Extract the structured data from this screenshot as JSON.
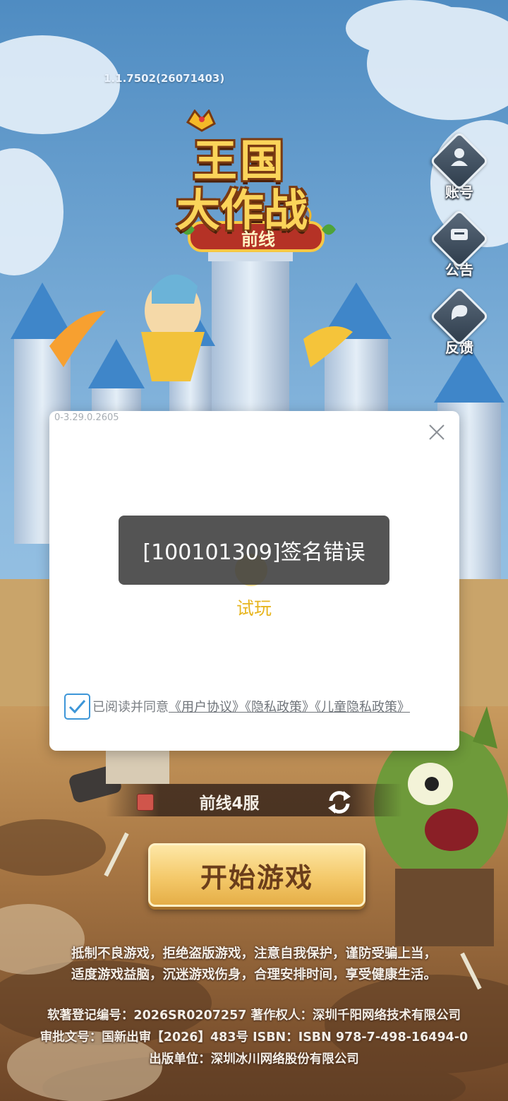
{
  "version": "1.1.7502(26071403)",
  "logo": {
    "title_line1": "王国",
    "title_line2": "大作战",
    "subtitle": "前线"
  },
  "side_menu": [
    {
      "label": "账号",
      "icon": "user-icon"
    },
    {
      "label": "公告",
      "icon": "notice-icon"
    },
    {
      "label": "反馈",
      "icon": "feedback-icon"
    }
  ],
  "dialog": {
    "version": "0-3.29.0.2605",
    "toast": "[100101309]签名错误",
    "trial_label": "试玩",
    "agreement": {
      "checked": true,
      "prefix": "已阅读并同意",
      "links": "《用户协议》《隐私政策》《儿童隐私政策》"
    }
  },
  "server": {
    "name": "前线4服",
    "status_color": "#d0554b"
  },
  "start_button": "开始游戏",
  "footer": {
    "health_line1": "抵制不良游戏，拒绝盗版游戏，注意自我保护，谨防受骗上当，",
    "health_line2": "适度游戏益脑，沉迷游戏伤身，合理安排时间，享受健康生活。",
    "copyright_line1": "软著登记编号：2026SR0207257 著作权人：深圳千阳网络技术有限公司",
    "copyright_line2": "审批文号：国新出审【2026】483号 ISBN：ISBN 978-7-498-16494-0",
    "copyright_line3": "出版单位：深圳冰川网络股份有限公司"
  }
}
